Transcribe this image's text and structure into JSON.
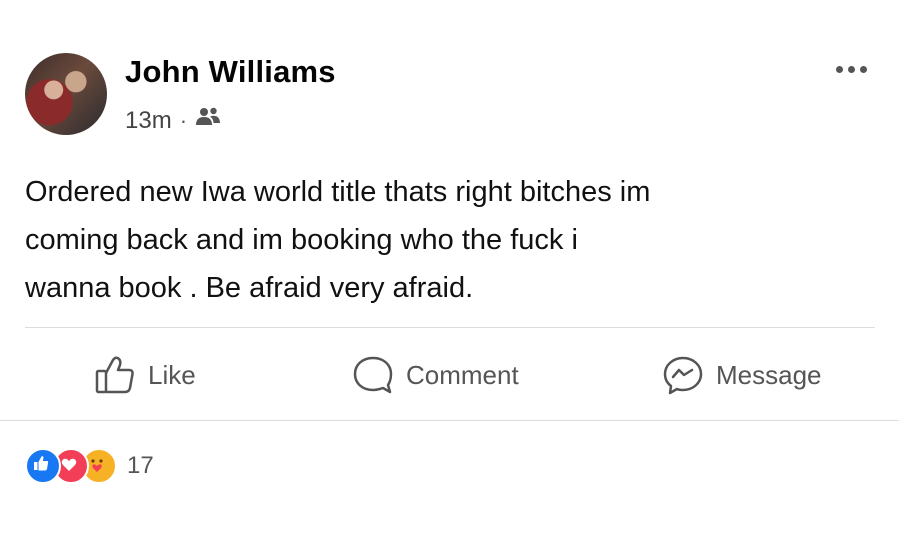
{
  "post": {
    "author": "John Williams",
    "time": "13m",
    "separator": "·",
    "text_lines": [
      "Ordered new Iwa world title thats right bitches im",
      "coming back and im booking who the fuck i",
      "wanna book . Be afraid very afraid."
    ]
  },
  "actions": {
    "like": "Like",
    "comment": "Comment",
    "message": "Message"
  },
  "reactions": {
    "count": "17",
    "types": [
      "like",
      "love",
      "care"
    ]
  },
  "icons": {
    "audience": "friends-icon",
    "more": "more-options-icon"
  },
  "colors": {
    "like_blue": "#1877f2",
    "love_red": "#f33e58",
    "care_yellow": "#f7b125"
  }
}
